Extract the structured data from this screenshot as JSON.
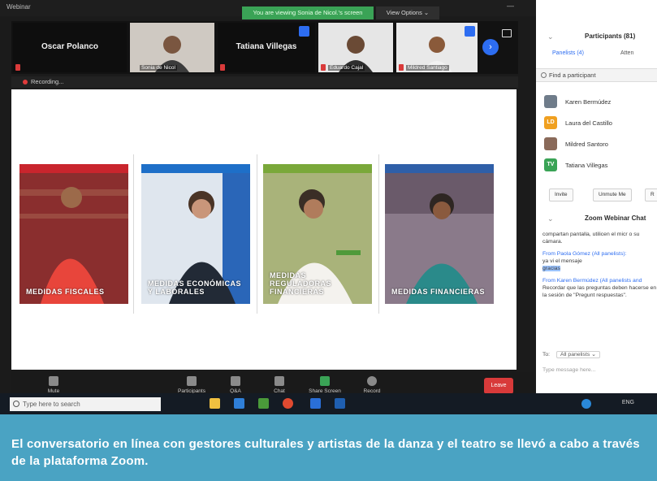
{
  "window": {
    "title": "Webinar",
    "sharing_banner": "You are viewing Sonia de Nicol.'s screen",
    "view_options": "View Options ⌄"
  },
  "thumbnails": [
    {
      "name": "Oscar Polanco",
      "kind": "name"
    },
    {
      "name": "Sonia de Nicol",
      "kind": "video"
    },
    {
      "name": "Tatiana Villegas",
      "kind": "name"
    },
    {
      "name": "Eduardo Cajal",
      "kind": "video"
    },
    {
      "name": "Mildred Santiago",
      "kind": "video"
    }
  ],
  "recording_label": "Recording...",
  "cards": [
    {
      "caption": "Medidas Fiscales",
      "bar_color": "#c9252d",
      "photo_color": "#b83a3a"
    },
    {
      "caption": "Medidas Económicas y Laborales",
      "bar_color": "#1e6fc8",
      "photo_color": "#3b4f6b"
    },
    {
      "caption": "Medidas Reguladoras Financieras",
      "bar_color": "#7aa83a",
      "photo_color": "#6d7d4a"
    },
    {
      "caption": "Medidas Financieras",
      "bar_color": "#2f5fa8",
      "photo_color": "#5a4f6a"
    }
  ],
  "controls": {
    "mute": "Mute",
    "participants": "Participants",
    "qa": "Q&A",
    "chat": "Chat",
    "share": "Share Screen",
    "record": "Record",
    "leave": "Leave"
  },
  "taskbar": {
    "search_placeholder": "Type here to search",
    "tray": "ENG"
  },
  "panel": {
    "title": "Participants (81)",
    "tab_panelists": "Panelists (4)",
    "tab_attendees": "Atten",
    "find": "Find a participant",
    "participants": [
      {
        "name": "Karen Bermúdez",
        "initials": "",
        "color": "#6f7c8a"
      },
      {
        "name": "Laura del Castillo",
        "initials": "LD",
        "color": "#f0a020"
      },
      {
        "name": "Mildred Santoro",
        "initials": "",
        "color": "#8a6a5a"
      },
      {
        "name": "Tatiana Villegas",
        "initials": "TV",
        "color": "#3aa356"
      }
    ],
    "btn_invite": "Invite",
    "btn_unmute": "Unmute Me",
    "btn_r": "R"
  },
  "chat": {
    "title": "Zoom Webinar Chat",
    "msg1": "compartan pantalla, utilicen el micr o su cámara.",
    "from1": "From Paola Gómez (All panelists):",
    "msg2a": "ya vi el mensaje",
    "msg2b": "gracias",
    "from2": "From Karen Bermúdez (All panelists and",
    "msg3": "Recordar que las preguntas deben hacerse en la sesión de \"Pregunt respuestas\".",
    "to_label": "To:",
    "to_value": "All panelists ⌄",
    "input_placeholder": "Type message here..."
  },
  "caption": "El conversatorio en línea con gestores culturales y artistas de la danza y el teatro se llevó a cabo a través de la plataforma Zoom."
}
